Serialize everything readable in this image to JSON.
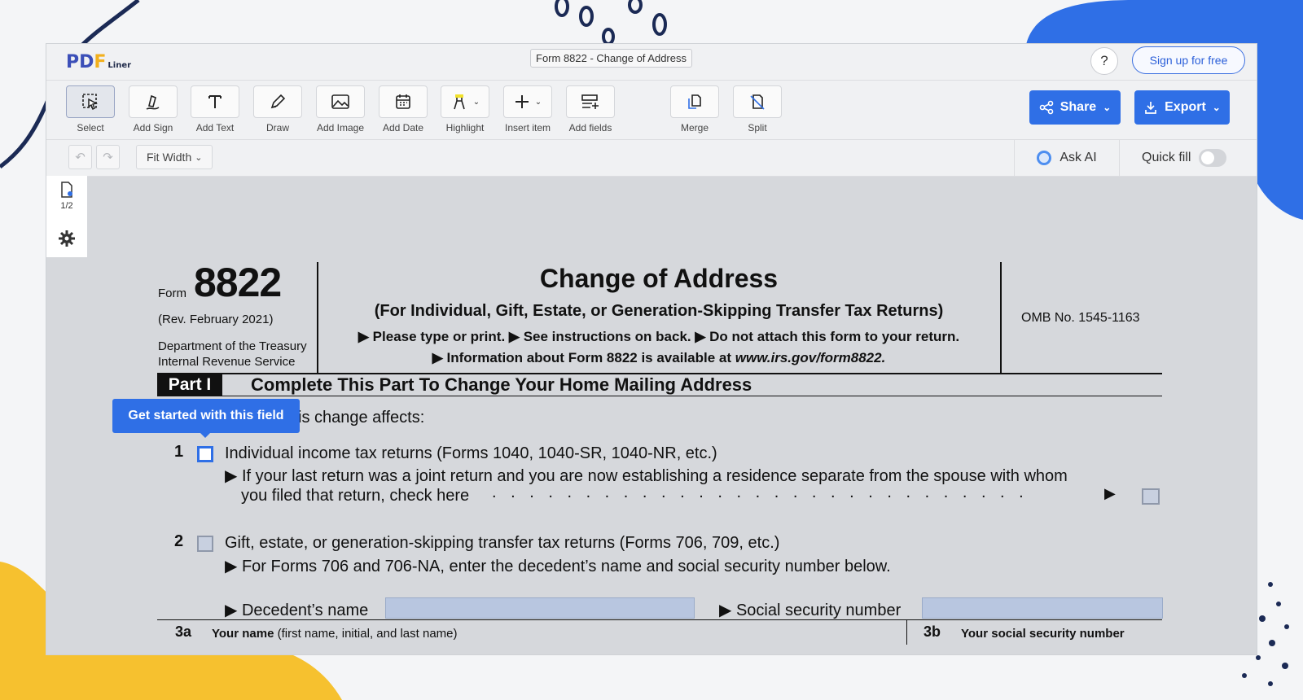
{
  "app": {
    "logo": {
      "p": "P",
      "d": "D",
      "f": "F",
      "suffix": "Liner"
    },
    "doc_title": "Form 8822 - Change of Address",
    "help_label": "?",
    "signup_label": "Sign up for free"
  },
  "toolbar": {
    "tools": [
      {
        "label": "Select",
        "icon": "select-icon"
      },
      {
        "label": "Add Sign",
        "icon": "sign-icon"
      },
      {
        "label": "Add Text",
        "icon": "text-icon"
      },
      {
        "label": "Draw",
        "icon": "draw-icon"
      },
      {
        "label": "Add Image",
        "icon": "image-icon"
      },
      {
        "label": "Add Date",
        "icon": "calendar-icon"
      },
      {
        "label": "Highlight",
        "icon": "highlight-icon"
      },
      {
        "label": "Insert item",
        "icon": "plus-icon"
      },
      {
        "label": "Add fields",
        "icon": "fields-icon"
      },
      {
        "label": "Merge",
        "icon": "merge-icon"
      },
      {
        "label": "Split",
        "icon": "split-icon"
      }
    ],
    "share_label": "Share",
    "export_label": "Export",
    "accent": "#2f6fe6"
  },
  "subbar": {
    "fit_label": "Fit Width",
    "ask_ai_label": "Ask AI",
    "quick_fill_label": "Quick fill",
    "quick_fill_on": false
  },
  "sidebar": {
    "page_indicator": "1/2"
  },
  "tooltip": "Get started with this field",
  "form": {
    "form_word": "Form",
    "number": "8822",
    "rev": "(Rev. February 2021)",
    "dept1": "Department of the Treasury",
    "dept2": "Internal Revenue Service",
    "title": "Change of Address",
    "subtitle": "(For Individual, Gift, Estate, or Generation-Skipping Transfer Tax Returns)",
    "instruction1": "▶ Please type or print.  ▶ See instructions on back.  ▶ Do not attach this form to your return.",
    "instruction2_prefix": "▶ Information about Form 8822 is available at ",
    "instruction2_url": "www.irs.gov/form8822.",
    "omb": "OMB No. 1545-1163",
    "part_label": "Part I",
    "part_title": "Complete This Part To Change Your Home Mailing Address",
    "affects_text": "is change affects:",
    "line1_num": "1",
    "line1_text": "Individual income tax returns (Forms 1040, 1040-SR, 1040-NR, etc.)",
    "line1_sub1": "▶ If your last return was a joint return and you are now establishing a residence separate from the spouse with whom",
    "line1_sub2": "you filed that return, check here",
    "line1_dots": ". . . . . . . . . . . . . . . . . . . . . . . . . . . . .",
    "arrow": "▶",
    "line2_num": "2",
    "line2_text": "Gift, estate, or generation-skipping transfer tax returns (Forms 706, 709, etc.)",
    "line2_sub": "▶ For Forms 706 and 706-NA, enter the decedent’s name and social security number below.",
    "decedent_label": "▶ Decedent’s name",
    "ssn_label": "▶ Social security number",
    "line3a_num": "3a",
    "line3a_bold": "Your name",
    "line3a_rest": " (first name, initial, and last name)",
    "line3b_num": "3b",
    "line3b_text": "Your social security number"
  }
}
